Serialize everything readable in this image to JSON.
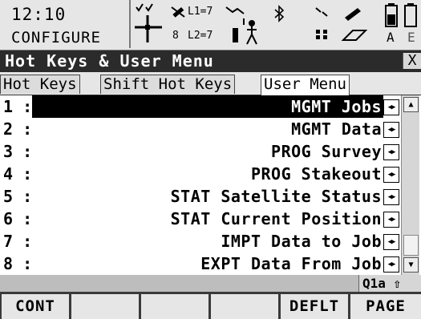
{
  "status": {
    "time": "12:10",
    "mode": "CONFIGURE",
    "l1_label": "L1",
    "l1_count": "7",
    "l2_label": "L2",
    "l2_count": "7",
    "sat_count": "8",
    "input_mode_letter": "A",
    "input_mode_letter2": "E"
  },
  "title": "Hot Keys & User Menu",
  "close_label": "X",
  "tabs": [
    {
      "label": "Hot Keys",
      "active": false
    },
    {
      "label": "Shift Hot Keys",
      "active": false
    },
    {
      "label": "User Menu",
      "active": true
    }
  ],
  "rows": [
    {
      "num": "1 :",
      "value": "MGMT Jobs",
      "selected": true
    },
    {
      "num": "2 :",
      "value": "MGMT Data",
      "selected": false
    },
    {
      "num": "3 :",
      "value": "PROG Survey",
      "selected": false
    },
    {
      "num": "4 :",
      "value": "PROG Stakeout",
      "selected": false
    },
    {
      "num": "5 :",
      "value": "STAT Satellite Status",
      "selected": false
    },
    {
      "num": "6 :",
      "value": "STAT Current Position",
      "selected": false
    },
    {
      "num": "7 :",
      "value": "IMPT Data to Job",
      "selected": false
    },
    {
      "num": "8 :",
      "value": "EXPT Data From Job",
      "selected": false
    }
  ],
  "input_mode": "Q1a",
  "fkeys": [
    "CONT",
    "",
    "",
    "",
    "DEFLT",
    "PAGE"
  ]
}
